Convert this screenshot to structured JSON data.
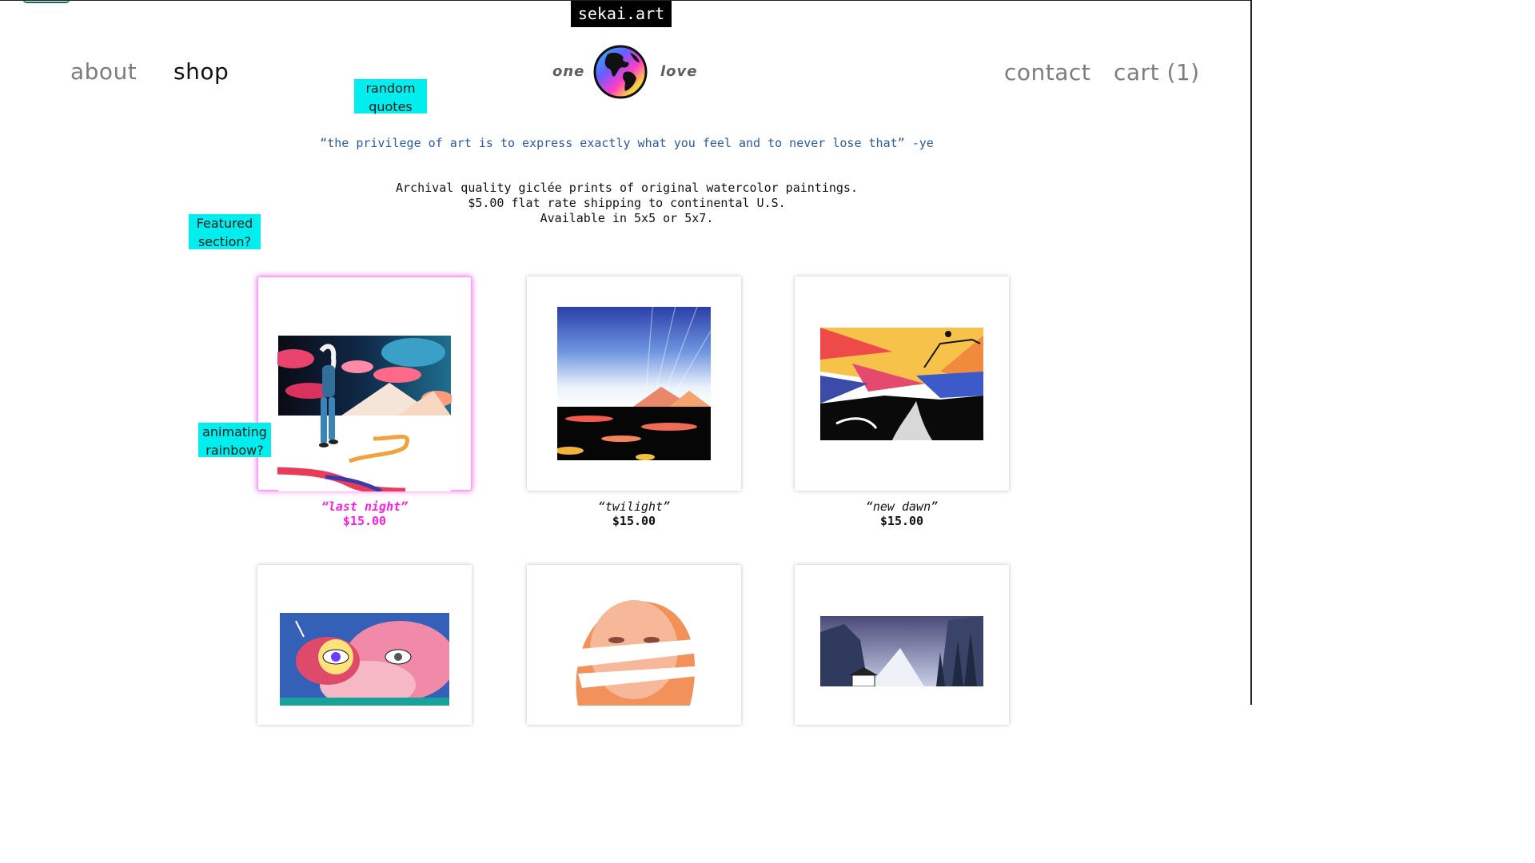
{
  "brand": "sekai.art",
  "nav": {
    "about": "about",
    "shop": "shop",
    "contact": "contact",
    "cart": "cart (1)"
  },
  "tagline": {
    "left": "one",
    "right": "love"
  },
  "notes": {
    "quotes": [
      "random",
      "quotes"
    ],
    "featured": [
      "Featured",
      "section?"
    ],
    "rainbow": [
      "animating",
      "rainbow?"
    ]
  },
  "quote": "“the privilege of art is to express exactly what you feel and to never lose that” -ye",
  "intro": [
    "Archival quality giclée prints of original watercolor paintings.",
    "$5.00 flat rate shipping to continental U.S.",
    "Available in 5x5 or 5x7."
  ],
  "products": [
    {
      "title": "“last night”",
      "price": "$15.00"
    },
    {
      "title": "“twilight”",
      "price": "$15.00"
    },
    {
      "title": "“new dawn”",
      "price": "$15.00"
    }
  ],
  "colors": {
    "note_bg": "#00eeee",
    "highlight": "#ff1fe0",
    "quote": "#2c5aa0",
    "nav_muted": "#7d7d7d"
  }
}
